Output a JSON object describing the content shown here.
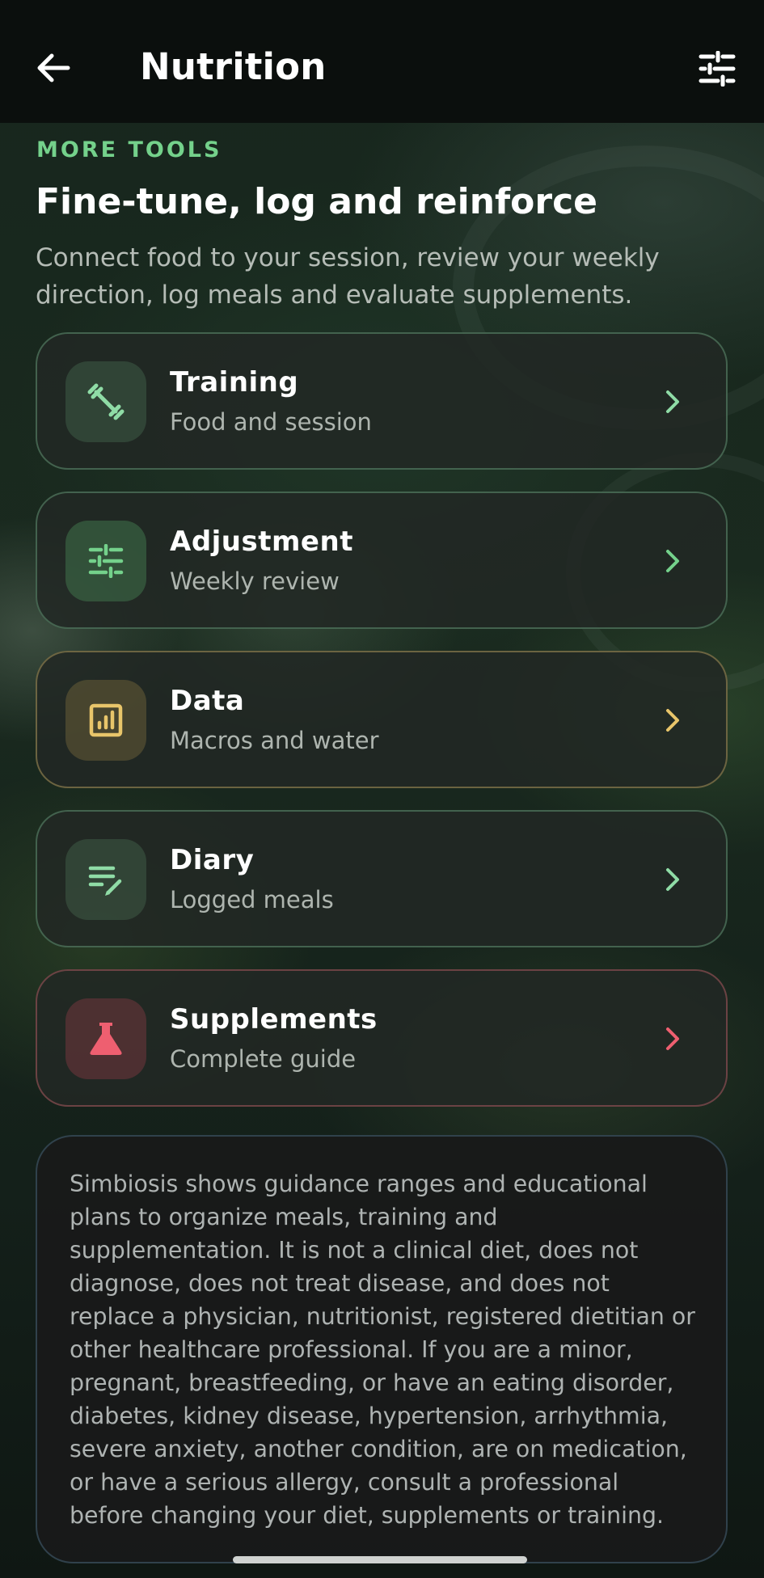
{
  "app_bar": {
    "title": "Nutrition",
    "back_icon": "arrow-left-icon",
    "filter_icon": "sliders-icon"
  },
  "section": {
    "eyebrow": "MORE TOOLS",
    "heading": "Fine-tune, log and reinforce",
    "subtitle": "Connect food to your session, review your weekly direction, log meals and evaluate supplements."
  },
  "cards": [
    {
      "title": "Training",
      "subtitle": "Food and session",
      "icon": "dumbbell-icon",
      "accent": "#8fdca6"
    },
    {
      "title": "Adjustment",
      "subtitle": "Weekly review",
      "icon": "sliders-icon",
      "accent": "#74d18b"
    },
    {
      "title": "Data",
      "subtitle": "Macros and water",
      "icon": "chart-icon",
      "accent": "#e8c56a"
    },
    {
      "title": "Diary",
      "subtitle": "Logged meals",
      "icon": "edit-list-icon",
      "accent": "#8fdca6"
    },
    {
      "title": "Supplements",
      "subtitle": "Complete guide",
      "icon": "flask-icon",
      "accent": "#ee5f70"
    }
  ],
  "disclaimer": "Simbiosis shows guidance ranges and educational plans to organize meals, training and supplementation. It is not a clinical diet, does not diagnose, does not treat disease, and does not replace a physician, nutritionist, registered dietitian or other healthcare professional. If you are a minor, pregnant, breastfeeding, or have an eating disorder, diabetes, kidney disease, hypertension, arrhythmia, severe anxiety, another condition, are on medication, or have a serious allergy, consult a professional before changing your diet, supplements or training."
}
